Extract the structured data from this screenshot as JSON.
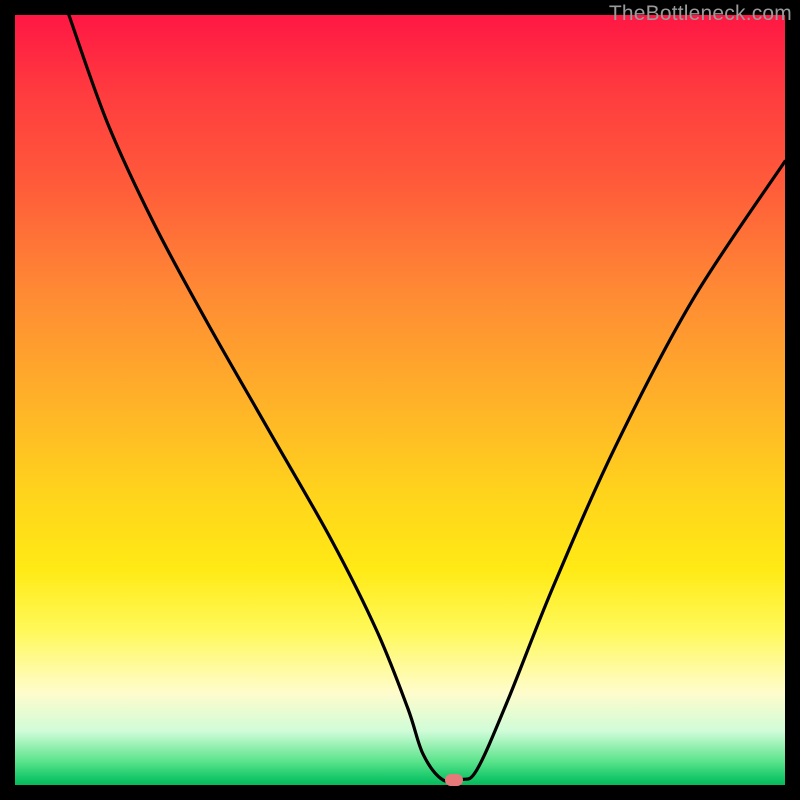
{
  "watermark": "TheBottleneck.com",
  "chart_data": {
    "type": "line",
    "title": "",
    "xlabel": "",
    "ylabel": "",
    "xlim": [
      0,
      100
    ],
    "ylim": [
      0,
      100
    ],
    "grid": false,
    "legend": false,
    "series": [
      {
        "name": "curve",
        "x": [
          7,
          12,
          18,
          25,
          33,
          41,
          47,
          51,
          53,
          55.5,
          58,
          60,
          64,
          70,
          78,
          88,
          100
        ],
        "values": [
          100,
          86,
          73,
          60,
          46,
          32,
          20,
          10,
          4,
          0.7,
          0.7,
          2,
          11,
          26,
          44,
          63,
          81
        ]
      }
    ],
    "marker": {
      "x": 57,
      "y": 0.6,
      "color": "#e67a7a"
    },
    "background_gradient": {
      "top": "#ff1744",
      "bottom": "#08b85c",
      "stops": [
        "#ff1744",
        "#ff5b3a",
        "#ff8a34",
        "#ffd31c",
        "#fff95a",
        "#59e38a",
        "#08b85c"
      ]
    }
  }
}
